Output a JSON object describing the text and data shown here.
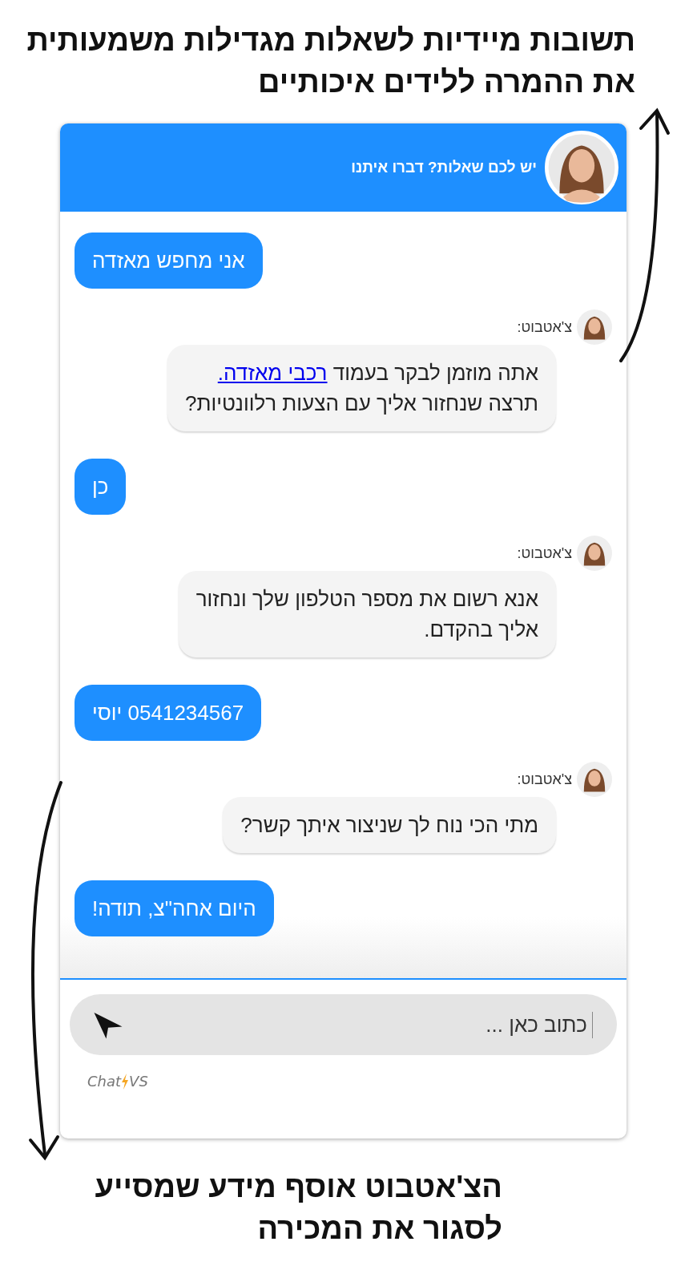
{
  "headline": [
    "תשובות מיידיות לשאלות מגדילות משמעותית",
    "את ההמרה ללידים איכותיים"
  ],
  "chat": {
    "title": "יש לכם שאלות? דברו איתנו",
    "messages": [
      {
        "kind": "user",
        "lines": [
          [
            {
              "kind": "text",
              "text": "אני מחפש מאזדה"
            }
          ]
        ]
      },
      {
        "kind": "bot",
        "sender": "צ'אטבוט:",
        "lines": [
          [
            {
              "kind": "text",
              "text": "אתה מוזמן לבקר בעמוד "
            },
            {
              "kind": "link",
              "text": "רכבי מאזדה."
            }
          ],
          [
            {
              "kind": "text",
              "text": "תרצה שנחזור אליך עם הצעות רלוונטיות?"
            }
          ]
        ]
      },
      {
        "kind": "user",
        "lines": [
          [
            {
              "kind": "text",
              "text": "כן"
            }
          ]
        ]
      },
      {
        "kind": "bot",
        "sender": "צ'אטבוט:",
        "lines": [
          [
            {
              "kind": "text",
              "text": "אנא רשום את מספר הטלפון שלך ונחזור"
            }
          ],
          [
            {
              "kind": "text",
              "text": "אליך בהקדם."
            }
          ]
        ]
      },
      {
        "kind": "user",
        "lines": [
          [
            {
              "kind": "text",
              "text": "0541234567 יוסי"
            }
          ]
        ]
      },
      {
        "kind": "bot",
        "sender": "צ'אטבוט:",
        "lines": [
          [
            {
              "kind": "text",
              "text": "מתי הכי נוח לך שניצור איתך קשר?"
            }
          ]
        ]
      },
      {
        "kind": "user",
        "lines": [
          [
            {
              "kind": "text",
              "text": "היום אחה\"צ, תודה!"
            }
          ]
        ]
      }
    ],
    "input": {
      "placeholder": "כתוב כאן ..."
    },
    "brand": {
      "name": "Chat",
      "suffix": "VS"
    }
  },
  "caption": [
    "הצ'אטבוט אוסף מידע שמסייע",
    "לסגור את המכירה"
  ]
}
